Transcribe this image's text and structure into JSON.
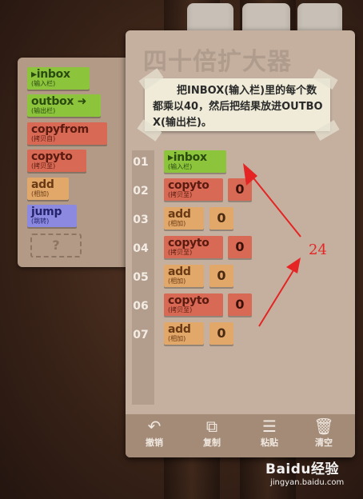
{
  "palette": {
    "items": [
      {
        "main": "inbox",
        "sub": "(输入栏)",
        "color": "green",
        "arrow": "before"
      },
      {
        "main": "outbox",
        "sub": "(输出栏)",
        "color": "green",
        "arrow": "after"
      },
      {
        "main": "copyfrom",
        "sub": "(拷贝自)",
        "color": "red"
      },
      {
        "main": "copyto",
        "sub": "(拷贝至)",
        "color": "red"
      },
      {
        "main": "add",
        "sub": "(相加)",
        "color": "orange"
      },
      {
        "main": "jump",
        "sub": "(跳转)",
        "color": "purple"
      }
    ],
    "unknown": "?"
  },
  "level": {
    "title": "四十倍扩大器",
    "instructions": "把INBOX(输入栏)里的每个数都乘以40，然后把结果放进OUTBOX(输出栏)。"
  },
  "program": [
    {
      "line": "01",
      "main": "inbox",
      "sub": "(输入栏)",
      "color": "green"
    },
    {
      "line": "02",
      "main": "copyto",
      "sub": "(拷贝至)",
      "color": "red",
      "arg": "0"
    },
    {
      "line": "03",
      "main": "add",
      "sub": "(相加)",
      "color": "orange",
      "arg": "0"
    },
    {
      "line": "04",
      "main": "copyto",
      "sub": "(拷贝至)",
      "color": "red",
      "arg": "0"
    },
    {
      "line": "05",
      "main": "add",
      "sub": "(相加)",
      "color": "orange",
      "arg": "0"
    },
    {
      "line": "06",
      "main": "copyto",
      "sub": "(拷贝至)",
      "color": "red",
      "arg": "0"
    },
    {
      "line": "07",
      "main": "add",
      "sub": "(相加)",
      "color": "orange",
      "arg": "0"
    }
  ],
  "toolbar": {
    "undo": "撤销",
    "copy": "复制",
    "paste": "粘贴",
    "clear": "清空"
  },
  "annotation": {
    "number": "24",
    "color": "#e52424"
  },
  "watermark": {
    "brand": "Baidu经验",
    "site": "jingyan.baidu.com"
  }
}
